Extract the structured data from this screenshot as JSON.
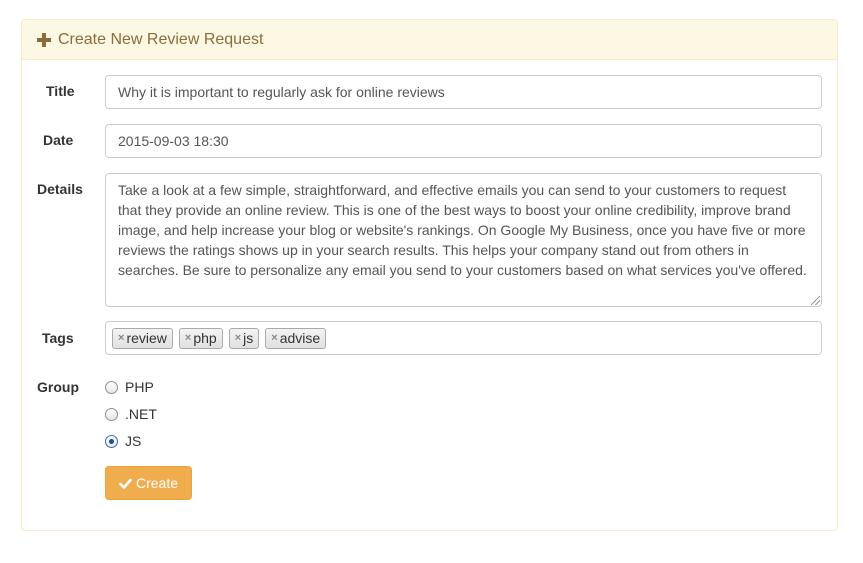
{
  "panel": {
    "heading": "Create New Review Request",
    "heading_icon": "plus-icon"
  },
  "form": {
    "title_label": "Title",
    "title_value": "Why it is important to regularly ask for online reviews",
    "date_label": "Date",
    "date_value": "2015-09-03 18:30",
    "details_label": "Details",
    "details_value": "Take a look at a few simple, straightforward, and effective emails you can send to your customers to request that they provide an online review. This is one of the best ways to boost your online credibility, improve brand image, and help increase your blog or website's rankings.  On Google My Business, once you have five or more reviews the ratings shows up in your search results. This helps your company stand out from others in searches. Be sure to personalize any email you send to your customers based on what services you've offered.",
    "tags_label": "Tags",
    "tags": [
      {
        "label": "review"
      },
      {
        "label": "php"
      },
      {
        "label": "js"
      },
      {
        "label": "advise"
      }
    ],
    "tag_remove_glyph": "×",
    "group_label": "Group",
    "group_options": [
      {
        "label": "PHP",
        "checked": false
      },
      {
        "label": ".NET",
        "checked": false
      },
      {
        "label": "JS",
        "checked": true
      }
    ],
    "submit_label": "Create"
  },
  "colors": {
    "panel_border": "#faebcc",
    "heading_bg": "#fcf8e3",
    "heading_text": "#8a6d3b",
    "button_bg": "#f0ad4e"
  }
}
